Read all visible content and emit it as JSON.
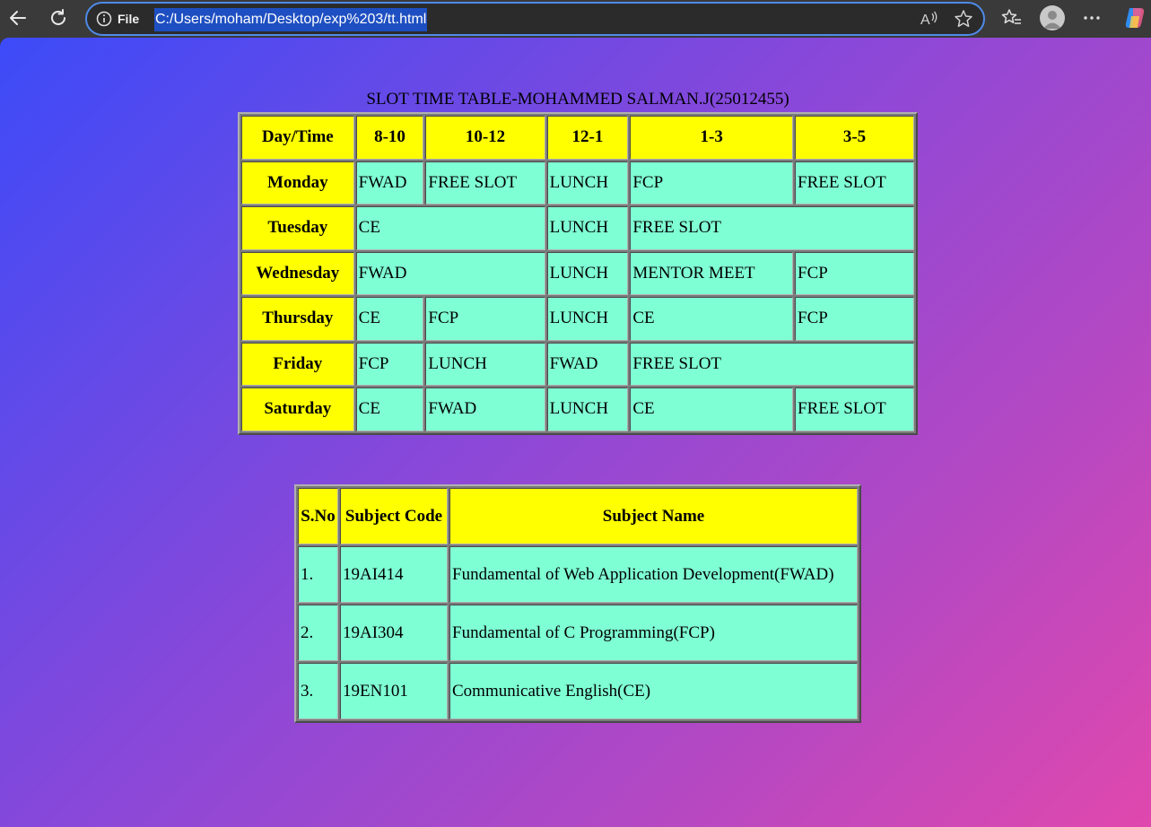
{
  "browser": {
    "file_label": "File",
    "url": "C:/Users/moham/Desktop/exp%203/tt.html"
  },
  "timetable": {
    "caption": "SLOT TIME TABLE-MOHAMMED SALMAN.J(25012455)",
    "headers": [
      "Day/Time",
      "8-10",
      "10-12",
      "12-1",
      "1-3",
      "3-5"
    ],
    "rows": [
      {
        "day": "Monday",
        "cells": [
          {
            "text": "FWAD",
            "span": 1
          },
          {
            "text": "FREE SLOT",
            "span": 1
          },
          {
            "text": "LUNCH",
            "span": 1
          },
          {
            "text": "FCP",
            "span": 1
          },
          {
            "text": "FREE SLOT",
            "span": 1
          }
        ]
      },
      {
        "day": "Tuesday",
        "cells": [
          {
            "text": "CE",
            "span": 2
          },
          {
            "text": "LUNCH",
            "span": 1
          },
          {
            "text": "FREE SLOT",
            "span": 2
          }
        ]
      },
      {
        "day": "Wednesday",
        "cells": [
          {
            "text": "FWAD",
            "span": 2
          },
          {
            "text": "LUNCH",
            "span": 1
          },
          {
            "text": "MENTOR MEET",
            "span": 1
          },
          {
            "text": "FCP",
            "span": 1
          }
        ]
      },
      {
        "day": "Thursday",
        "cells": [
          {
            "text": "CE",
            "span": 1
          },
          {
            "text": "FCP",
            "span": 1
          },
          {
            "text": "LUNCH",
            "span": 1
          },
          {
            "text": "CE",
            "span": 1
          },
          {
            "text": "FCP",
            "span": 1
          }
        ]
      },
      {
        "day": "Friday",
        "cells": [
          {
            "text": "FCP",
            "span": 1
          },
          {
            "text": "LUNCH",
            "span": 1
          },
          {
            "text": "FWAD",
            "span": 1
          },
          {
            "text": "FREE SLOT",
            "span": 2
          }
        ]
      },
      {
        "day": "Saturday",
        "cells": [
          {
            "text": "CE",
            "span": 1
          },
          {
            "text": "FWAD",
            "span": 1
          },
          {
            "text": "LUNCH",
            "span": 1
          },
          {
            "text": "CE",
            "span": 1
          },
          {
            "text": "FREE SLOT",
            "span": 1
          }
        ]
      }
    ]
  },
  "subjects": {
    "headers": [
      "S.No",
      "Subject Code",
      "Subject Name"
    ],
    "rows": [
      [
        "1.",
        "19AI414",
        "Fundamental of Web Application Development(FWAD)"
      ],
      [
        "2.",
        "19AI304",
        "Fundamental of C Programming(FCP)"
      ],
      [
        "3.",
        "19EN101",
        "Communicative English(CE)"
      ]
    ]
  },
  "colors": {
    "header_cell": "#ffff00",
    "data_cell": "#7fffd4",
    "gradient_start": "#3c4bf8",
    "gradient_end": "#e048ad"
  },
  "icons": [
    "back-icon",
    "refresh-icon",
    "info-icon",
    "read-aloud-icon",
    "favorite-star-icon",
    "favorites-list-icon",
    "profile-avatar-icon",
    "more-icon",
    "copilot-icon"
  ]
}
